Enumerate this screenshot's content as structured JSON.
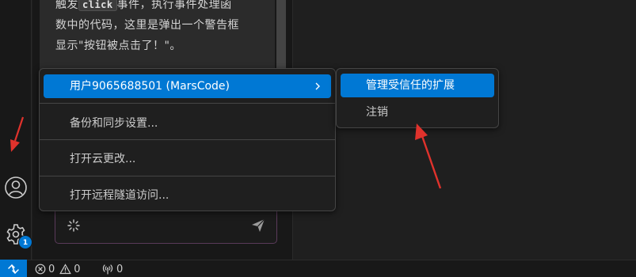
{
  "chat": {
    "line1_prefix": "触发",
    "code": "click",
    "line1_suffix": "事件，执行事件处理函",
    "line2": "数中的代码，这里是弹出一个警告框",
    "line3": "显示\"按钮被点击了！\"。"
  },
  "activity_bar": {
    "account_icon": "account-icon",
    "manage_icon": "gear-icon",
    "manage_badge": "1"
  },
  "accounts_menu": {
    "items": [
      {
        "label": "用户9065688501 (MarsCode)",
        "has_submenu": true,
        "active": true
      },
      {
        "label": "备份和同步设置..."
      },
      {
        "label": "打开云更改..."
      },
      {
        "label": "打开远程隧道访问..."
      }
    ]
  },
  "submenu": {
    "items": [
      {
        "label": "管理受信任的扩展",
        "active": true
      },
      {
        "label": "注销"
      }
    ]
  },
  "status_bar": {
    "errors": "0",
    "warnings": "0",
    "ports": "0"
  },
  "colors": {
    "accent": "#0078d4",
    "annotation": "#e0322c"
  }
}
